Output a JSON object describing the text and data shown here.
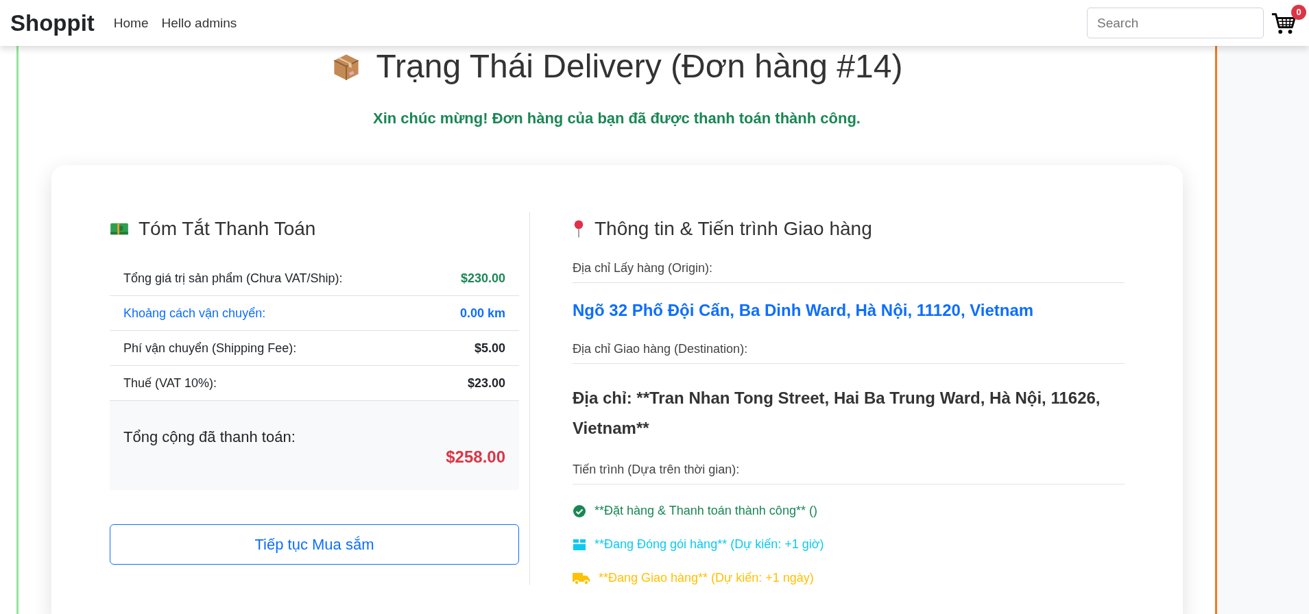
{
  "navbar": {
    "brand": "Shoppit",
    "links": [
      "Home",
      "Hello admins"
    ],
    "search": {
      "placeholder": "Search"
    },
    "cart": {
      "count": "0"
    }
  },
  "page": {
    "title": "Trạng Thái Delivery (Đơn hàng #14)",
    "success_message": "Xin chúc mừng! Đơn hàng của bạn đã được thanh toán thành công."
  },
  "payment_summary": {
    "title": "Tóm Tắt Thanh Toán",
    "rows": [
      {
        "label": "Tổng giá trị sản phẩm (Chưa VAT/Ship):",
        "value": "$230.00",
        "kind": "success"
      },
      {
        "label": "Khoảng cách vận chuyển:",
        "value": "0.00 km",
        "kind": "info"
      },
      {
        "label": "Phí vận chuyển (Shipping Fee):",
        "value": "$5.00",
        "kind": "plain"
      },
      {
        "label": "Thuế (VAT 10%):",
        "value": "$23.00",
        "kind": "plain"
      }
    ],
    "total": {
      "label": "Tổng cộng đã thanh toán:",
      "value": "$258.00"
    },
    "continue_button": "Tiếp tục Mua sắm"
  },
  "delivery": {
    "title": "Thông tin & Tiến trình Giao hàng",
    "origin": {
      "label": "Địa chỉ Lấy hàng (Origin):",
      "address": "Ngõ 32 Phố Đội Cấn, Ba Dinh Ward, Hà Nội, 11120, Vietnam"
    },
    "destination": {
      "label": "Địa chỉ Giao hàng (Destination):",
      "address": "Địa chỉ: **Tran Nhan Tong Street, Hai Ba Trung Ward, Hà Nội, 11626, Vietnam**"
    },
    "progress": {
      "label": "Tiến trình (Dựa trên thời gian):",
      "steps": [
        {
          "kind": "done",
          "color": "#198754",
          "text": "**Đặt hàng & Thanh toán thành công** ()"
        },
        {
          "kind": "packing",
          "color": "#0dcaf0",
          "text": "**Đang Đóng gói hàng** (Dự kiến: +1 giờ)"
        },
        {
          "kind": "shipping",
          "color": "#ffc107",
          "text": "**Đang Giao hàng** (Dự kiến: +1 ngày)"
        }
      ]
    }
  }
}
